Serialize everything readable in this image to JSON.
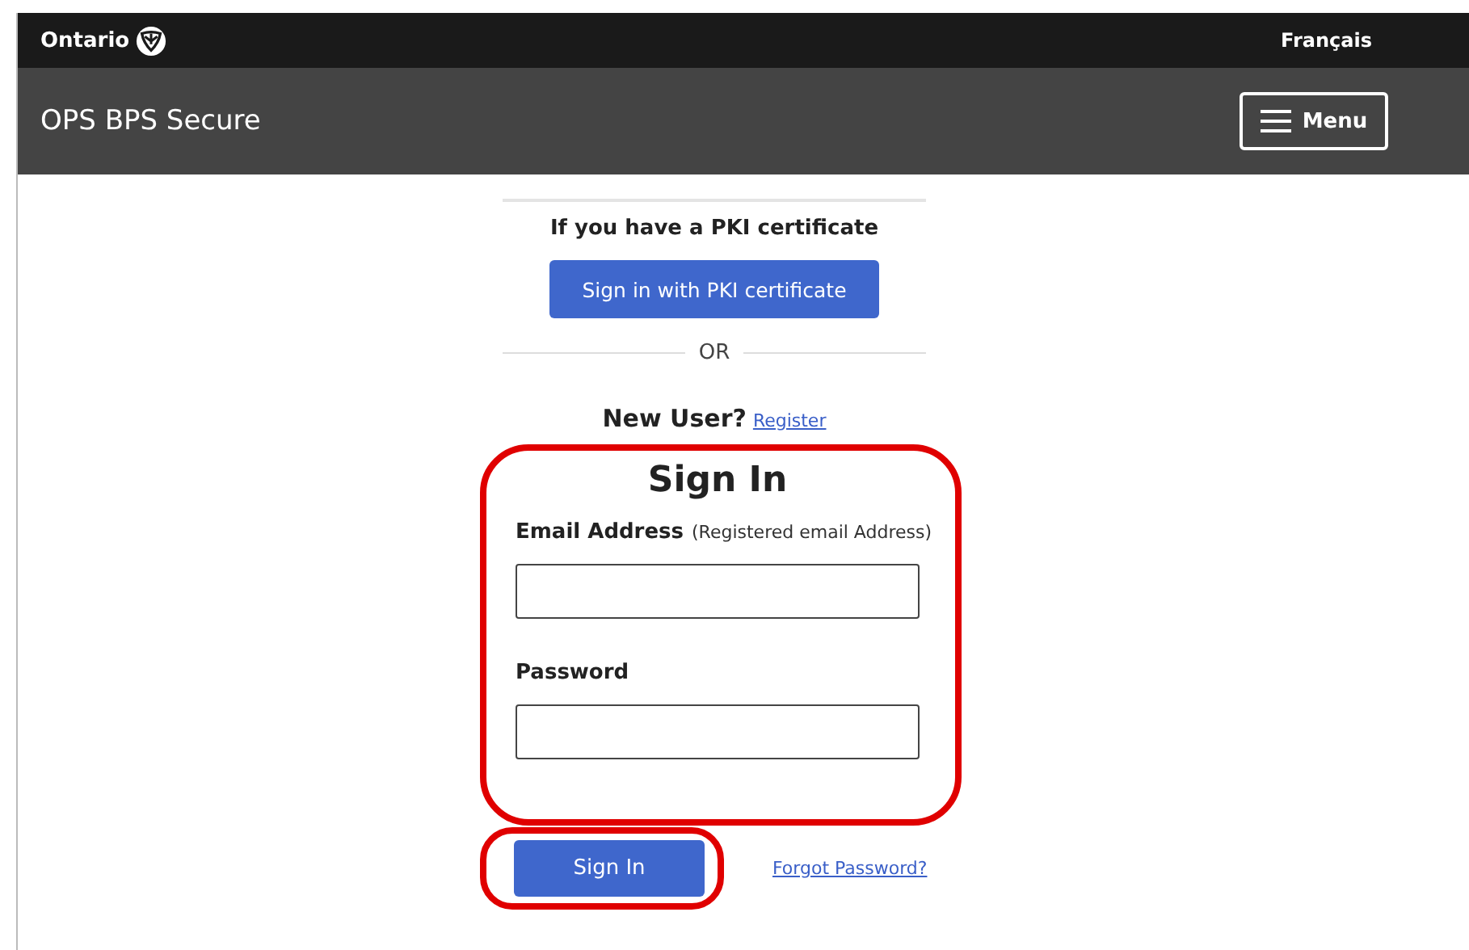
{
  "top_bar": {
    "logo": "Ontario",
    "language_link": "Français"
  },
  "header": {
    "title": "OPS BPS Secure",
    "menu_button": "Menu"
  },
  "pki": {
    "heading": "If you have a PKI certificate",
    "button": "Sign in with PKI certificate",
    "separator": "OR"
  },
  "new_user": {
    "label": "New User?",
    "link": "Register"
  },
  "sign_in_form": {
    "title": "Sign In",
    "highlighted": true,
    "fields": [
      {
        "label": "Email Address",
        "hint": "(Registered email Address)"
      },
      {
        "label": "Password"
      }
    ],
    "submit": {
      "label": "Sign In",
      "highlighted": true
    },
    "forgot_link": "Forgot Password?"
  }
}
